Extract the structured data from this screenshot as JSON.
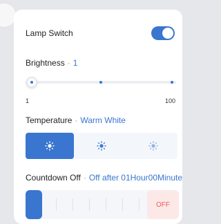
{
  "lamp_switch": {
    "label": "Lamp Switch",
    "state": "on"
  },
  "brightness": {
    "label": "Brightness",
    "separator": "·",
    "value": "1",
    "min_label": "1",
    "max_label": "100",
    "level": 1
  },
  "temperature": {
    "label": "Temperature",
    "separator": "·",
    "value": "Warm White",
    "options": [
      {
        "icon": "sun-icon",
        "selected": true
      },
      {
        "icon": "sun-icon",
        "selected": false
      },
      {
        "icon": "sun-icon",
        "selected": false
      }
    ]
  },
  "countdown": {
    "label": "Countdown Off",
    "separator": "·",
    "value": "Off after 01Hour00Minute",
    "off_label": "OFF"
  },
  "colors": {
    "accent": "#3a76cf",
    "off_bg": "#fde8e8",
    "off_text": "#ef5b5b"
  }
}
